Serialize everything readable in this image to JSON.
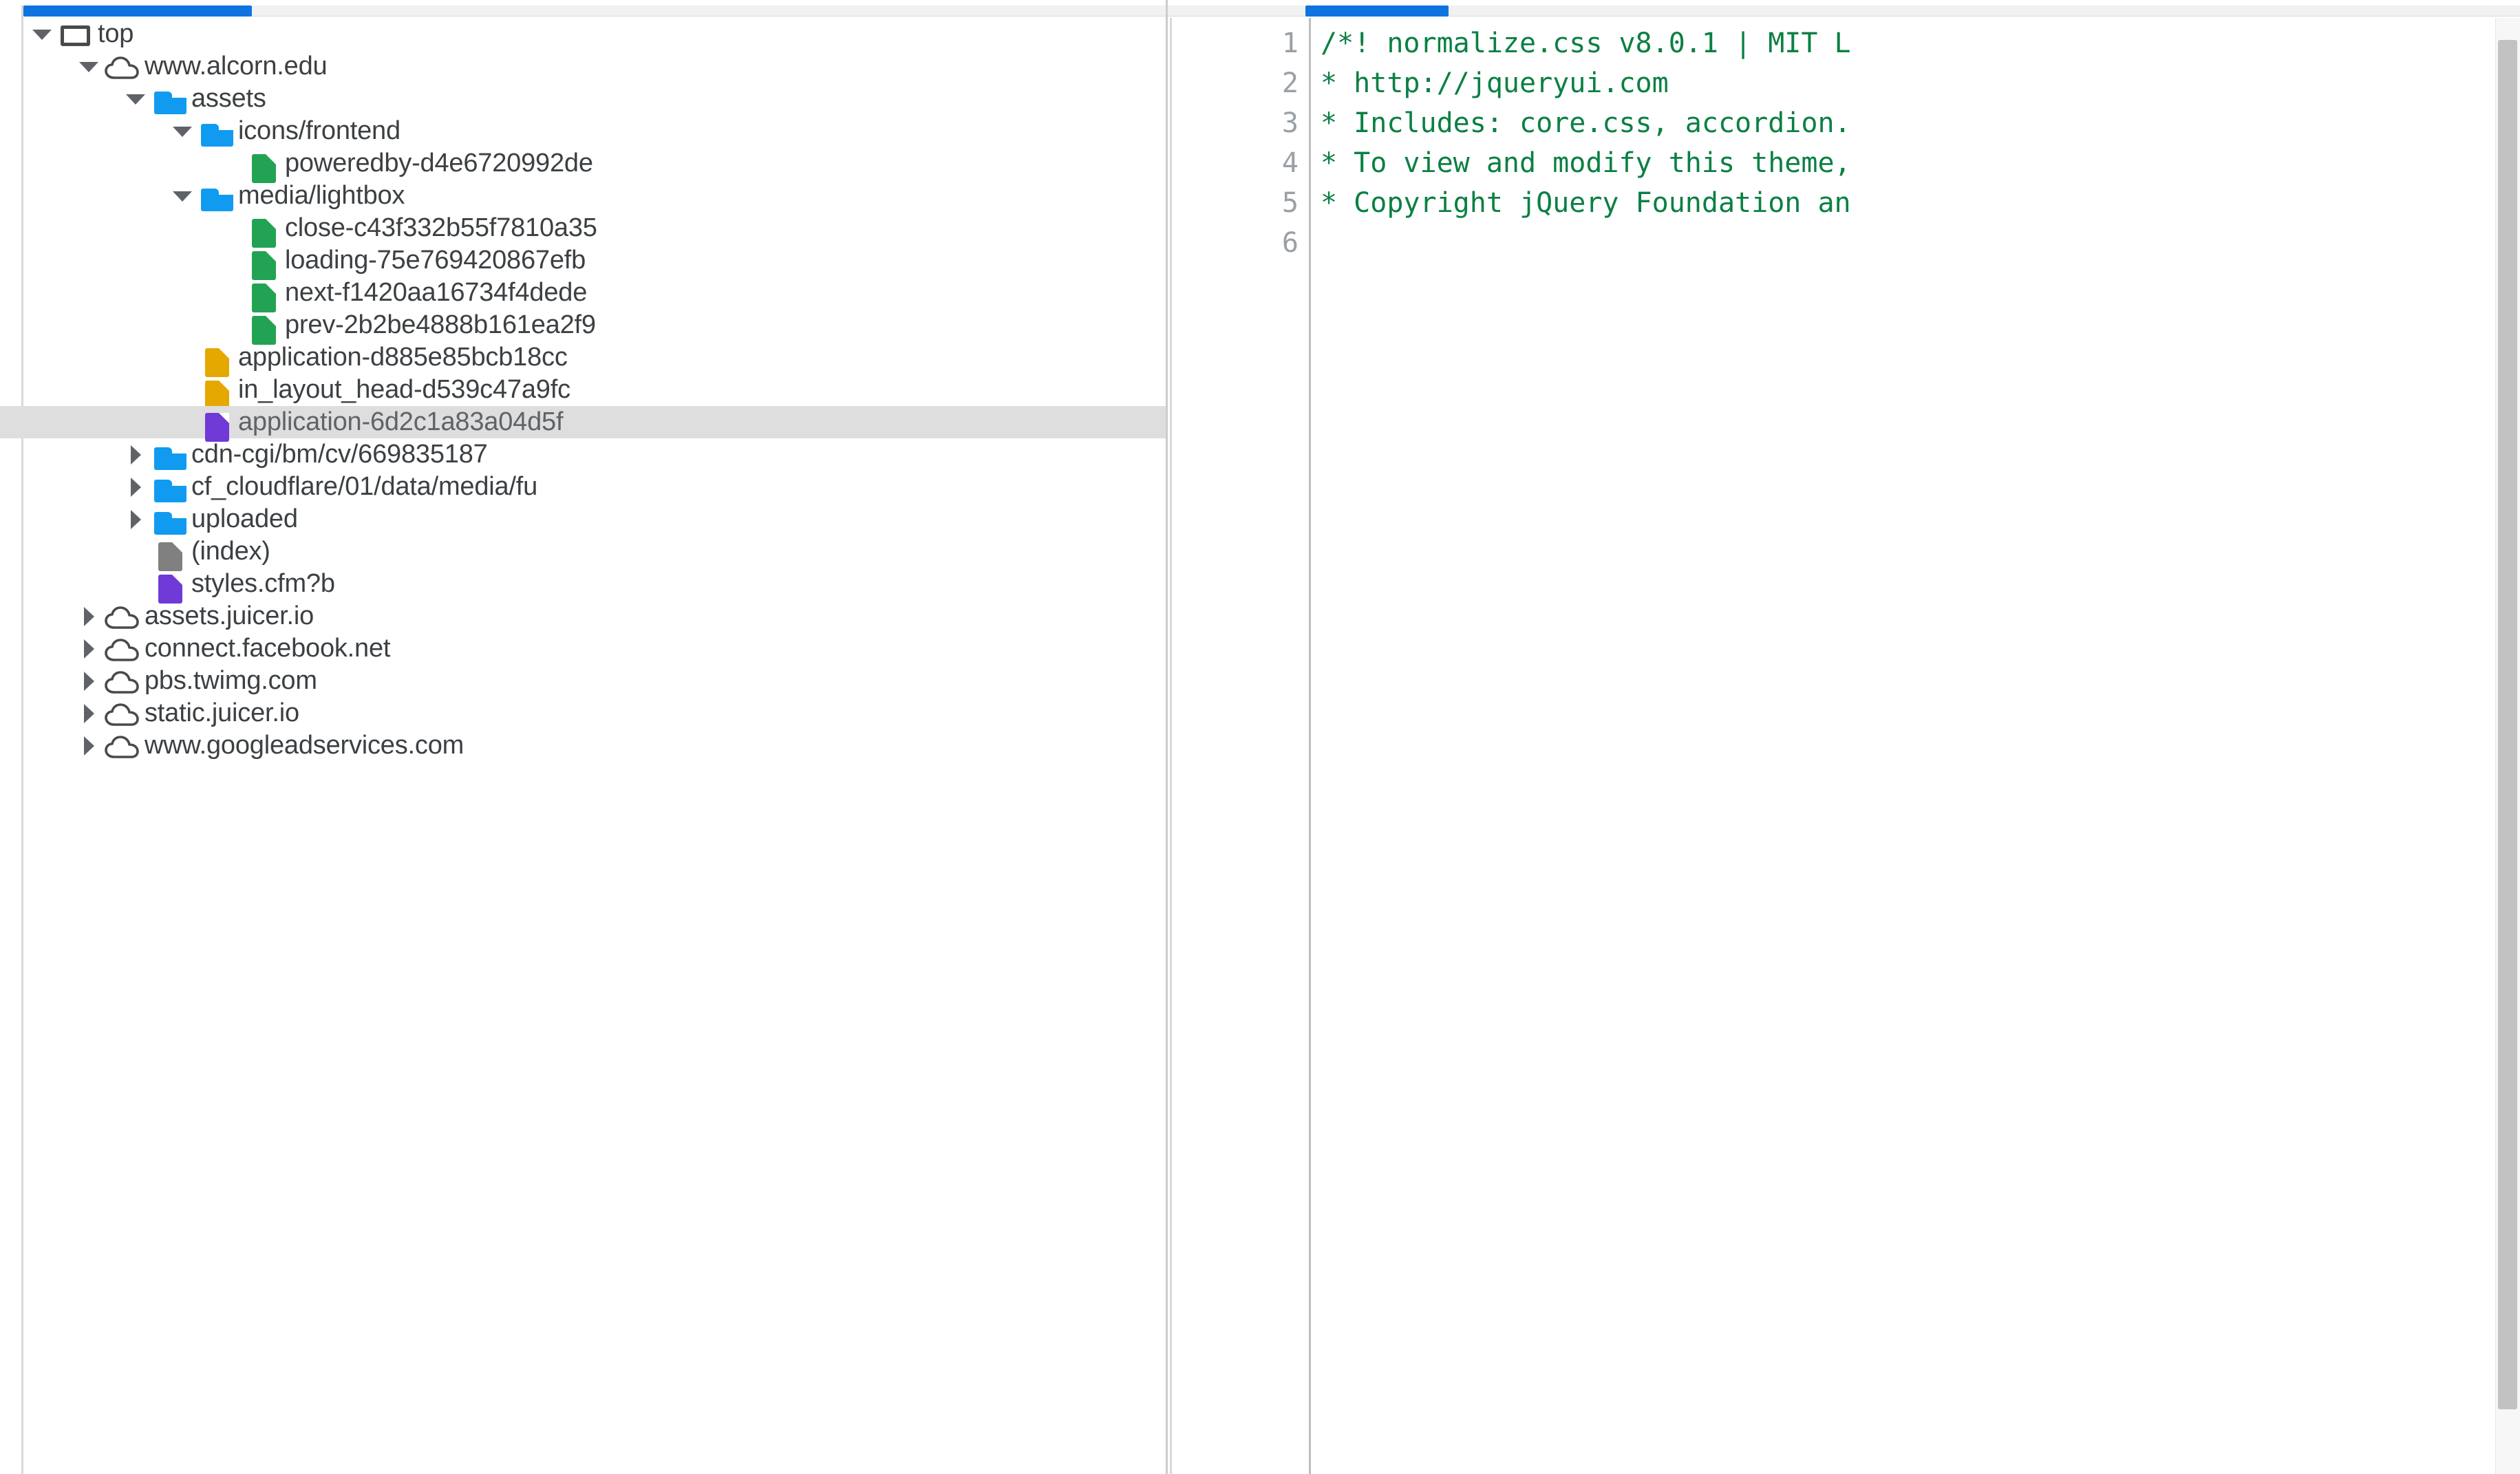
{
  "navigator": {
    "hscrollbar": {
      "thumb_color": "#0f74e0",
      "track_color": "#f1f1f1"
    },
    "tree": [
      {
        "label": "top",
        "icon": "frame-icon",
        "twisty": "open",
        "depth": 0,
        "selected": false
      },
      {
        "label": "www.alcorn.edu",
        "icon": "cloud-icon",
        "twisty": "open",
        "depth": 1,
        "selected": false
      },
      {
        "label": "assets",
        "icon": "folder-icon",
        "twisty": "open",
        "depth": 2,
        "selected": false
      },
      {
        "label": "icons/frontend",
        "icon": "folder-icon",
        "twisty": "open",
        "depth": 3,
        "selected": false
      },
      {
        "label": "poweredby-d4e6720992de",
        "icon": "image-file-icon",
        "twisty": "none",
        "depth": 4,
        "selected": false
      },
      {
        "label": "media/lightbox",
        "icon": "folder-icon",
        "twisty": "open",
        "depth": 3,
        "selected": false
      },
      {
        "label": "close-c43f332b55f7810a35",
        "icon": "image-file-icon",
        "twisty": "none",
        "depth": 4,
        "selected": false
      },
      {
        "label": "loading-75e769420867efb",
        "icon": "image-file-icon",
        "twisty": "none",
        "depth": 4,
        "selected": false
      },
      {
        "label": "next-f1420aa16734f4dede",
        "icon": "image-file-icon",
        "twisty": "none",
        "depth": 4,
        "selected": false
      },
      {
        "label": "prev-2b2be4888b161ea2f9",
        "icon": "image-file-icon",
        "twisty": "none",
        "depth": 4,
        "selected": false
      },
      {
        "label": "application-d885e85bcb18cc",
        "icon": "script-file-icon",
        "twisty": "none",
        "depth": 3,
        "selected": false
      },
      {
        "label": "in_layout_head-d539c47a9fc",
        "icon": "script-file-icon",
        "twisty": "none",
        "depth": 3,
        "selected": false
      },
      {
        "label": "application-6d2c1a83a04d5f",
        "icon": "stylesheet-file-icon",
        "twisty": "none",
        "depth": 3,
        "selected": true
      },
      {
        "label": "cdn-cgi/bm/cv/669835187",
        "icon": "folder-icon",
        "twisty": "closed",
        "depth": 2,
        "selected": false
      },
      {
        "label": "cf_cloudflare/01/data/media/fu",
        "icon": "folder-icon",
        "twisty": "closed",
        "depth": 2,
        "selected": false
      },
      {
        "label": "uploaded",
        "icon": "folder-icon",
        "twisty": "closed",
        "depth": 2,
        "selected": false
      },
      {
        "label": "(index)",
        "icon": "document-file-icon",
        "twisty": "none",
        "depth": 2,
        "selected": false
      },
      {
        "label": "styles.cfm?b",
        "icon": "stylesheet-file-icon",
        "twisty": "none",
        "depth": 2,
        "selected": false
      },
      {
        "label": "assets.juicer.io",
        "icon": "cloud-icon",
        "twisty": "closed",
        "depth": 1,
        "selected": false
      },
      {
        "label": "connect.facebook.net",
        "icon": "cloud-icon",
        "twisty": "closed",
        "depth": 1,
        "selected": false
      },
      {
        "label": "pbs.twimg.com",
        "icon": "cloud-icon",
        "twisty": "closed",
        "depth": 1,
        "selected": false
      },
      {
        "label": "static.juicer.io",
        "icon": "cloud-icon",
        "twisty": "closed",
        "depth": 1,
        "selected": false
      },
      {
        "label": "www.googleadservices.com",
        "icon": "cloud-icon",
        "twisty": "closed",
        "depth": 1,
        "selected": false
      }
    ],
    "icon_colors": {
      "folder-icon": "#119bf0",
      "image-file-icon": "#22a353",
      "script-file-icon": "#e5a800",
      "stylesheet-file-icon": "#6f3ad6",
      "document-file-icon": "#808080",
      "frame-icon": "#4a4a4a",
      "cloud-icon": "#4a4a4a"
    },
    "selected_row_bg": "#dedede"
  },
  "editor": {
    "active_tab_bar_color": "#0f74e0",
    "comment_color": "#0b8043",
    "gutter_color": "#9aa0a6",
    "lines": [
      {
        "number": "1",
        "text": "/*! normalize.css v8.0.1 | MIT L"
      },
      {
        "number": "2",
        "text": "* http://jqueryui.com"
      },
      {
        "number": "3",
        "text": "* Includes: core.css, accordion."
      },
      {
        "number": "4",
        "text": "* To view and modify this theme,"
      },
      {
        "number": "5",
        "text": "* Copyright jQuery Foundation an"
      },
      {
        "number": "6",
        "text": ""
      }
    ]
  }
}
